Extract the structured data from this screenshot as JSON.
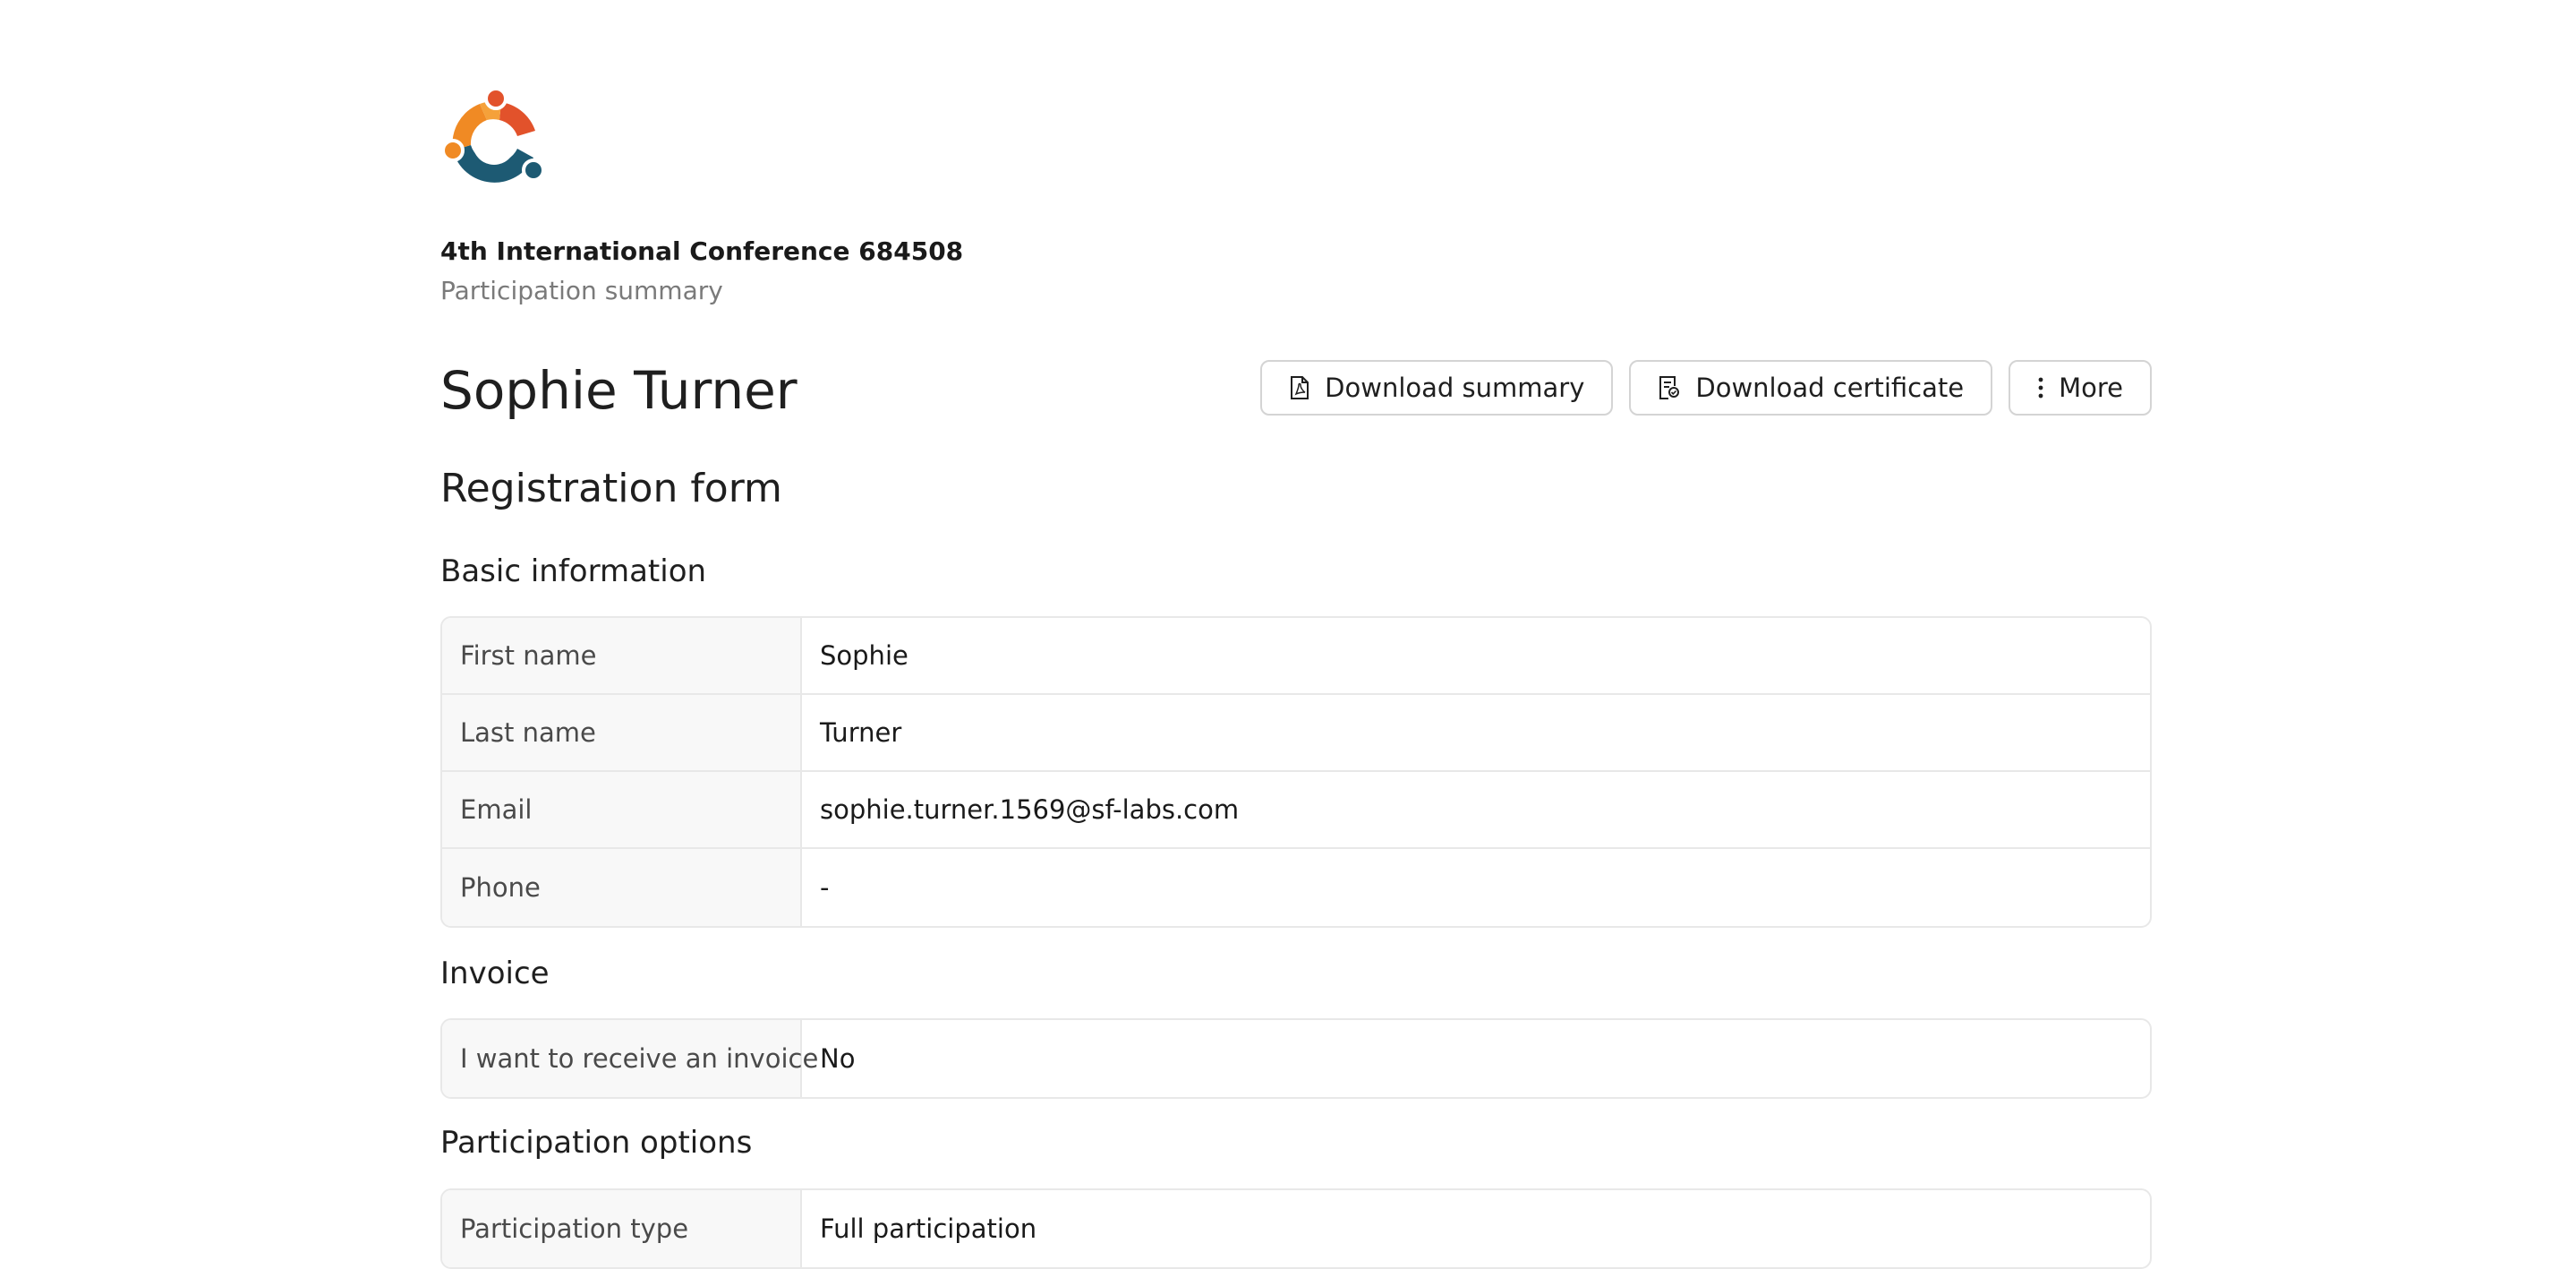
{
  "event": {
    "title": "4th International Conference 684508",
    "subtitle": "Participation summary"
  },
  "participant": {
    "name": "Sophie Turner"
  },
  "actions": {
    "download_summary": "Download summary",
    "download_certificate": "Download certificate",
    "more": "More"
  },
  "form": {
    "title": "Registration form",
    "groups": [
      {
        "title": "Basic information",
        "rows": [
          {
            "label": "First name",
            "value": "Sophie"
          },
          {
            "label": "Last name",
            "value": "Turner"
          },
          {
            "label": "Email",
            "value": "sophie.turner.1569@sf-labs.com"
          },
          {
            "label": "Phone",
            "value": "-"
          }
        ]
      },
      {
        "title": "Invoice",
        "rows": [
          {
            "label": "I want to receive an invoice",
            "value": "No"
          }
        ]
      },
      {
        "title": "Participation options",
        "rows": [
          {
            "label": "Participation type",
            "value": "Full participation"
          }
        ]
      }
    ]
  },
  "icons": {
    "logo": "conference-logo-icon",
    "download_summary": "pdf-file-icon",
    "download_certificate": "certificate-icon",
    "more": "vertical-ellipsis-icon"
  },
  "colors": {
    "logo_orange": "#f08a24",
    "logo_red": "#e2522b",
    "logo_teal": "#1d5a73",
    "border": "#d4d4d4",
    "label_bg": "#f8f8f8"
  }
}
